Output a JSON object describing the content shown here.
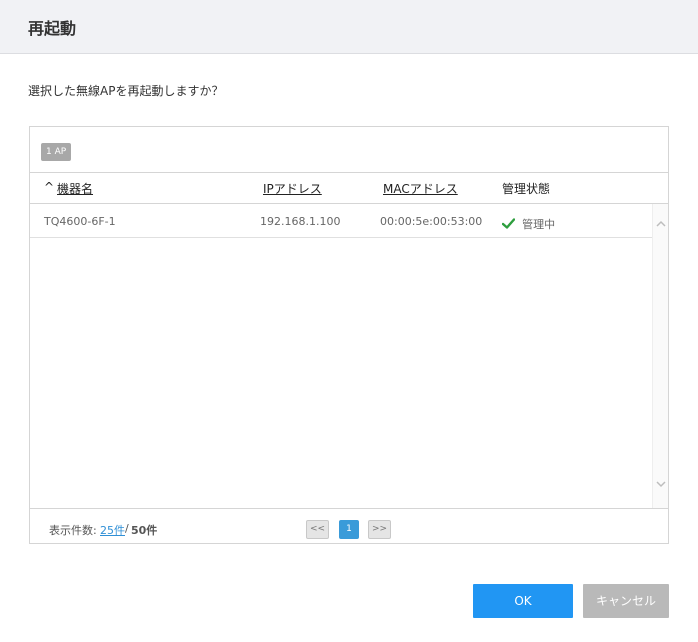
{
  "dialog": {
    "title": "再起動",
    "question": "選択した無線APを再起動しますか？"
  },
  "panel": {
    "count_badge": "1 AP",
    "sort_indicator": "^",
    "columns": [
      {
        "label": "機器名",
        "link": true
      },
      {
        "label": "IPアドレス",
        "link": true
      },
      {
        "label": "MACアドレス",
        "link": true
      },
      {
        "label": "管理状態",
        "link": false
      }
    ],
    "rows": [
      {
        "name": "TQ4600-6F-1",
        "ip": "192.168.1.100",
        "mac": "00:00:5e:00:53:00",
        "status": "管理中",
        "status_icon": "check-icon"
      }
    ],
    "footer": {
      "page_size_label": "表示件数:",
      "page_size_value": "25件",
      "separator": "/",
      "page_size_max": "50件",
      "prev_label": "<<",
      "current_page": "1",
      "next_label": ">>"
    }
  },
  "buttons": {
    "ok": "OK",
    "cancel": "キャンセル"
  },
  "colors": {
    "accent": "#2196f3",
    "status_ok": "#2e9e3e",
    "disabled": "#b9b9b9"
  }
}
